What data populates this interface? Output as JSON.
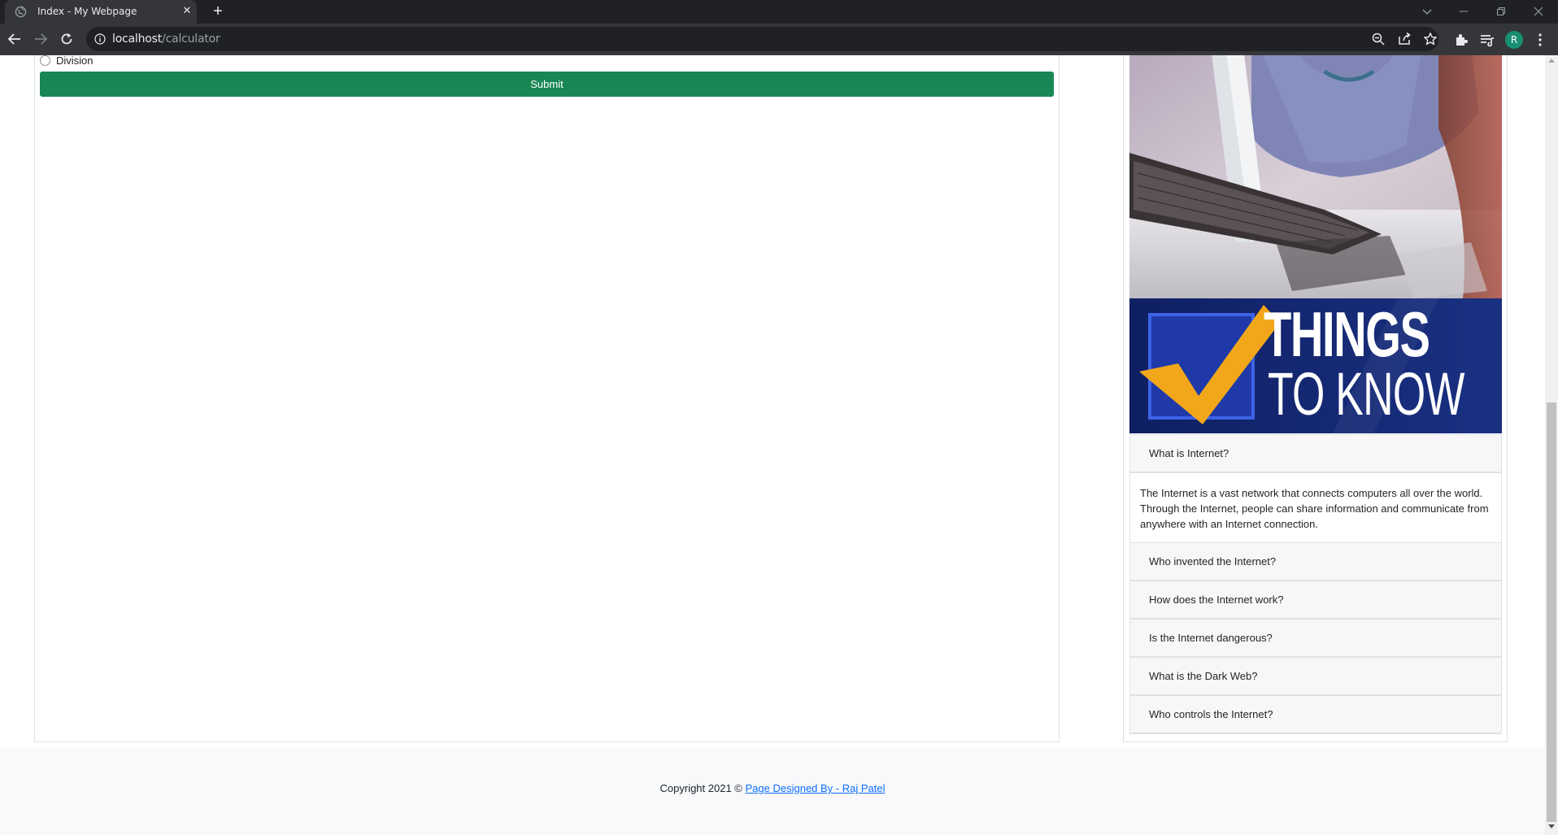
{
  "browser": {
    "tab_title": "Index - My Webpage",
    "tab_close": "✕",
    "new_tab": "+",
    "url_host": "localhost",
    "url_path": "/calculator",
    "profile_initial": "R"
  },
  "calculator": {
    "radio_label": "Division",
    "submit_label": "Submit",
    "submit_color": "#198754"
  },
  "sidebar": {
    "banner_text_line1": "THINGS",
    "banner_text_line2": "TO KNOW",
    "faq": [
      {
        "question": "What is Internet?",
        "answer": "The Internet is a vast network that connects computers all over the world. Through the Internet, people can share information and communicate from anywhere with an Internet connection.",
        "expanded": true
      },
      {
        "question": "Who invented the Internet?",
        "expanded": false
      },
      {
        "question": "How does the Internet work?",
        "expanded": false
      },
      {
        "question": "Is the Internet dangerous?",
        "expanded": false
      },
      {
        "question": "What is the Dark Web?",
        "expanded": false
      },
      {
        "question": "Who controls the Internet?",
        "expanded": false
      }
    ]
  },
  "footer": {
    "copyright": "Copyright 2021 ©",
    "link_text": "Page Designed By - Raj Patel",
    "link_color": "#0d6efd"
  }
}
